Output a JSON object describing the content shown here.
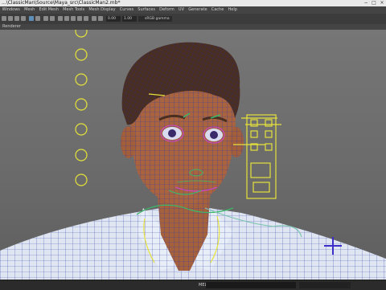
{
  "window": {
    "title": "...\\ClassicMan\\Source\\Maya_src\\ClassicMan2.mb*",
    "controls": [
      "−",
      "□",
      "×"
    ]
  },
  "menu": [
    "Windows",
    "Mesh",
    "Edit Mesh",
    "Mesh Tools",
    "Mesh Display",
    "Curves",
    "Surfaces",
    "Deform",
    "UV",
    "Generate",
    "Cache",
    "Help"
  ],
  "toolbar": {
    "value_a": "0.00",
    "value_b": "1.00",
    "colorspace": "sRGB gamma"
  },
  "panel": {
    "label": "Renderer"
  },
  "status": {
    "mel_label": "MEL"
  },
  "colors": {
    "skin": "#a9643f",
    "wireframe": "#3b3fa0",
    "shirt": "#dfe6f2",
    "hair": "#4a2e20",
    "controls": "#e6e23a"
  }
}
